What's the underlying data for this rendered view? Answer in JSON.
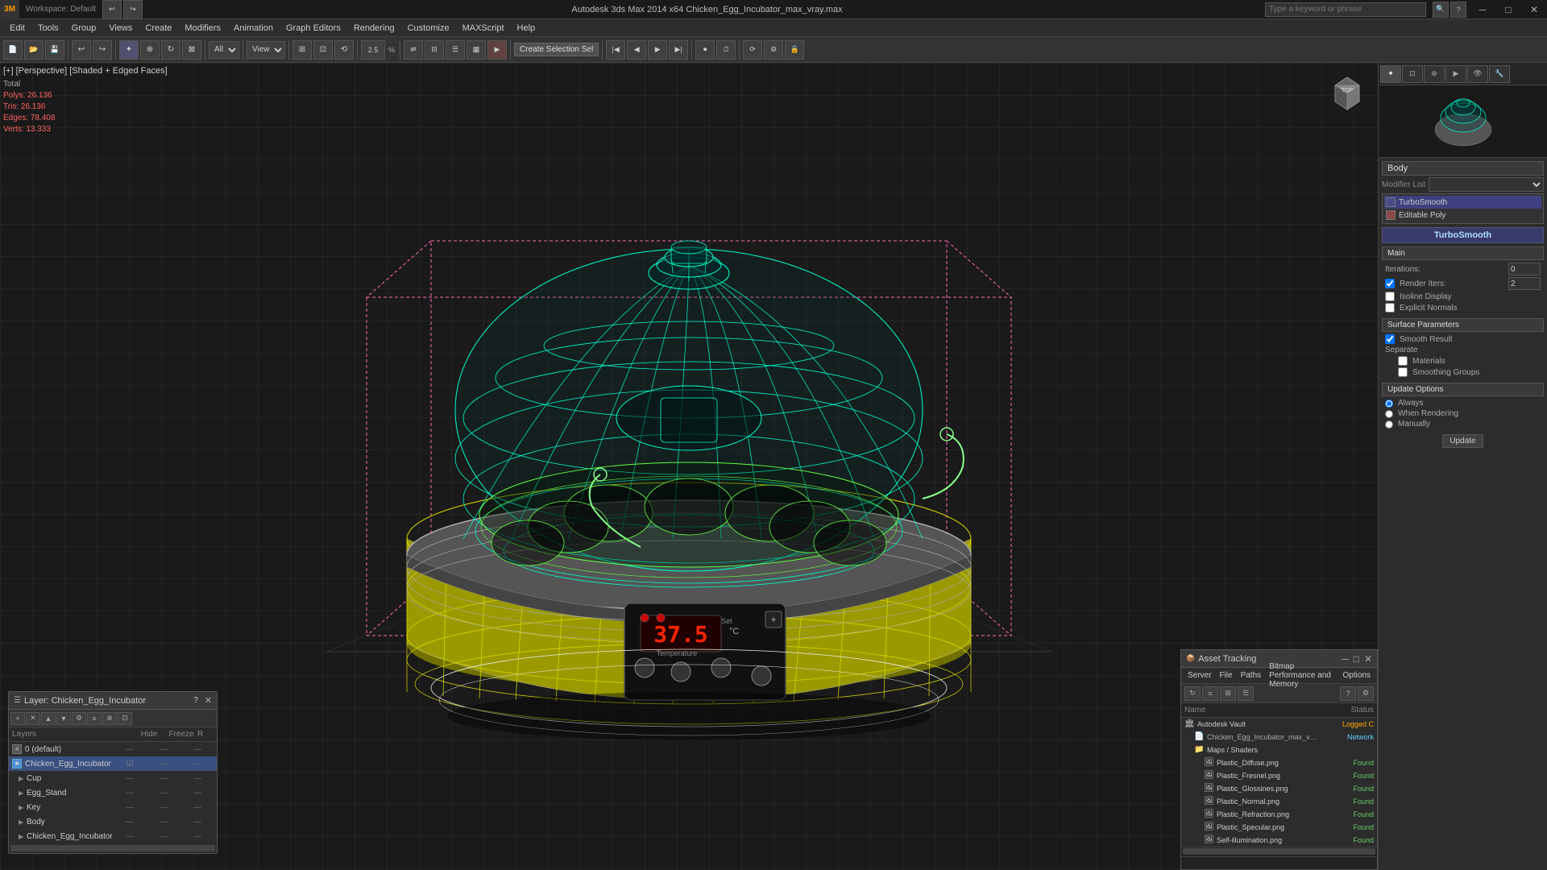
{
  "title_bar": {
    "app_name": "3ds Max",
    "file_name": "Chicken_Egg_Incubator_max_vray.max",
    "full_title": "Autodesk 3ds Max 2014 x64    Chicken_Egg_Incubator_max_vray.max",
    "search_placeholder": "Type a keyword or phrase",
    "min_btn": "─",
    "max_btn": "□",
    "close_btn": "✕"
  },
  "menu": {
    "items": [
      "Edit",
      "Tools",
      "Group",
      "Views",
      "Create",
      "Modifiers",
      "Animation",
      "Graph Editors",
      "Rendering",
      "Customize",
      "MAXScript",
      "Help"
    ]
  },
  "toolbar": {
    "workspace_label": "Workspace: Default",
    "all_label": "All",
    "view_label": "View",
    "create_selection": "Create Selection Sel",
    "percent_label": "2.5",
    "percent2_label": "2.5"
  },
  "viewport": {
    "label": "[+] [Perspective] [Shaded + Edged Faces]",
    "stats": {
      "polys_label": "Polys:",
      "polys_val": "26.136",
      "tris_label": "Tris:",
      "tris_val": "26.136",
      "edges_label": "Edges:",
      "edges_val": "78.408",
      "verts_label": "Verts:",
      "verts_val": "13.333",
      "total_label": "Total"
    }
  },
  "right_panel": {
    "title": "Body",
    "modifier_list_label": "Modifier List",
    "modifiers": [
      {
        "name": "TurboSmooth",
        "active": true
      },
      {
        "name": "Editable Poly",
        "active": false
      }
    ],
    "turbosmooth": {
      "title": "TurboSmooth",
      "main_label": "Main",
      "iterations_label": "Iterations:",
      "iterations_val": "0",
      "render_iters_label": "Render Iters:",
      "render_iters_val": "2",
      "isoline_label": "Isoline Display",
      "explicit_label": "Explicit Normals",
      "surface_label": "Surface Parameters",
      "smooth_result_label": "Smooth Result",
      "separate_label": "Separate",
      "materials_label": "Materials",
      "smoothing_label": "Smoothing Groups",
      "update_label": "Update Options",
      "always_label": "Always",
      "when_rendering_label": "When Rendering",
      "manually_label": "Manually",
      "update_btn": "Update"
    }
  },
  "layers": {
    "title": "Layer: Chicken_Egg_Incubator",
    "header": {
      "layers_col": "Layers",
      "hide_col": "Hide",
      "freeze_col": "Freeze",
      "r_col": "R"
    },
    "items": [
      {
        "name": "0 (default)",
        "indent": 0,
        "active": false,
        "dot": false
      },
      {
        "name": "Chicken_Egg_Incubator",
        "indent": 0,
        "active": true,
        "dot": true
      },
      {
        "name": "Cup",
        "indent": 1,
        "active": false,
        "dot": false
      },
      {
        "name": "Egg_Stand",
        "indent": 1,
        "active": false,
        "dot": false
      },
      {
        "name": "Key",
        "indent": 1,
        "active": false,
        "dot": false
      },
      {
        "name": "Body",
        "indent": 1,
        "active": false,
        "dot": false
      },
      {
        "name": "Chicken_Egg_Incubator",
        "indent": 1,
        "active": false,
        "dot": false
      }
    ]
  },
  "asset_tracking": {
    "title": "Asset Tracking",
    "menu_items": [
      "Server",
      "File",
      "Paths",
      "Bitmap Performance and Memory",
      "Options"
    ],
    "columns": {
      "name": "Name",
      "status": "Status"
    },
    "rows": [
      {
        "name": "Autodesk Vault",
        "status": "Logged C",
        "indent": 0,
        "type": "folder",
        "status_color": "logged"
      },
      {
        "name": "Chicken_Egg_Incubator_max_vray.max",
        "status": "Network",
        "indent": 1,
        "type": "file",
        "status_color": "network"
      },
      {
        "name": "Maps / Shaders",
        "status": "",
        "indent": 1,
        "type": "folder"
      },
      {
        "name": "Plastic_Diffuse.png",
        "status": "Found",
        "indent": 2,
        "type": "image",
        "status_color": "found"
      },
      {
        "name": "Plastic_Fresnel.png",
        "status": "Found",
        "indent": 2,
        "type": "image",
        "status_color": "found"
      },
      {
        "name": "Plastic_Glossines.png",
        "status": "Found",
        "indent": 2,
        "type": "image",
        "status_color": "found"
      },
      {
        "name": "Plastic_Normal.png",
        "status": "Found",
        "indent": 2,
        "type": "image",
        "status_color": "found"
      },
      {
        "name": "Plastic_Refraction.png",
        "status": "Found",
        "indent": 2,
        "type": "image",
        "status_color": "found"
      },
      {
        "name": "Plastic_Specular.png",
        "status": "Found",
        "indent": 2,
        "type": "image",
        "status_color": "found"
      },
      {
        "name": "Self-illumination.png",
        "status": "Found",
        "indent": 2,
        "type": "image",
        "status_color": "found"
      }
    ]
  },
  "icons": {
    "close": "✕",
    "minimize": "─",
    "maximize": "□",
    "folder": "📁",
    "file": "📄",
    "image": "🖼",
    "checkbox_checked": "☑",
    "checkbox_unchecked": "☐",
    "radio_on": "●",
    "radio_off": "○",
    "arrow_down": "▼",
    "arrow_right": "▶",
    "pin": "📌"
  },
  "colors": {
    "accent": "#4a90d9",
    "bg_dark": "#1a1a1a",
    "bg_mid": "#2c2c2c",
    "bg_light": "#3a3a3a",
    "border": "#555",
    "text_main": "#ccc",
    "text_dim": "#888",
    "found_color": "#66cc66",
    "network_color": "#66ccff",
    "logged_color": "#ffaa00",
    "pink_bbox": "#ff69b4",
    "cyan_wire": "#00ffcc",
    "stats_color": "#ff6060"
  }
}
